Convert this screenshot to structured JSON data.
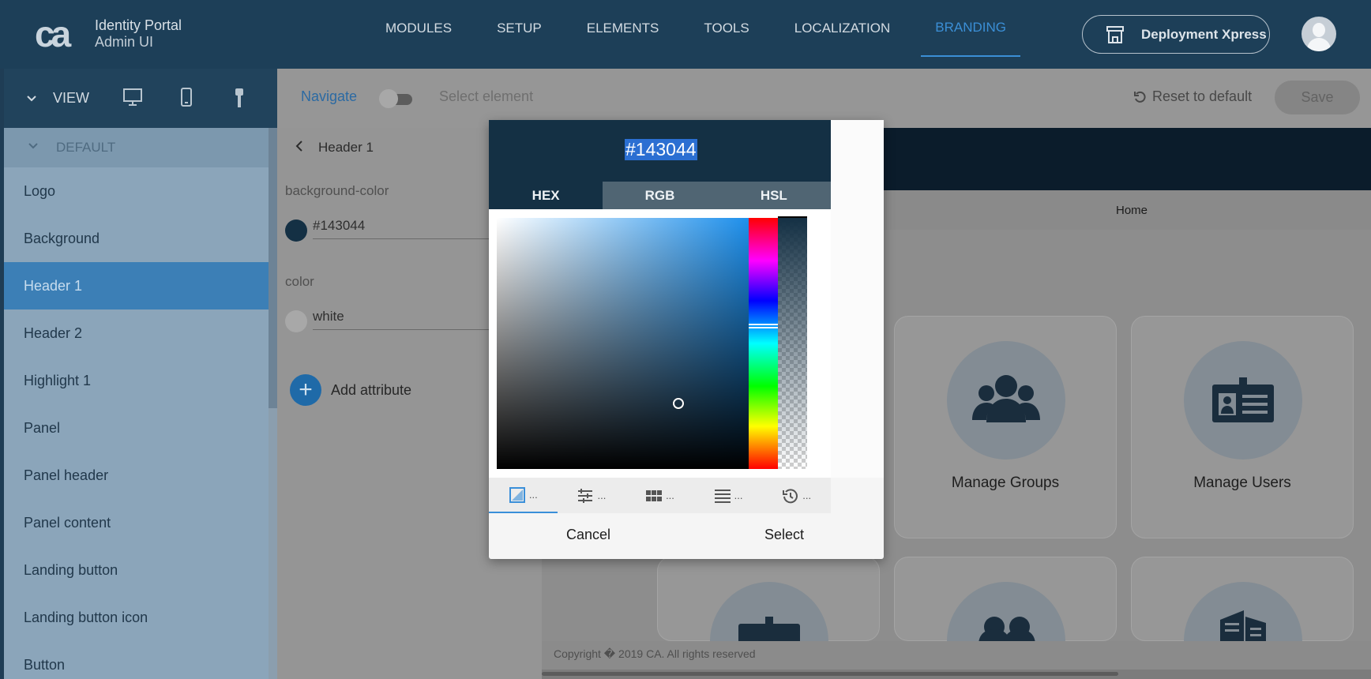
{
  "app": {
    "logo_mark": "ca",
    "title_line1": "Identity Portal",
    "title_line2": "Admin UI"
  },
  "topnav": {
    "items": [
      {
        "label": "MODULES",
        "active": false
      },
      {
        "label": "SETUP",
        "active": false
      },
      {
        "label": "ELEMENTS",
        "active": false
      },
      {
        "label": "TOOLS",
        "active": false
      },
      {
        "label": "LOCALIZATION",
        "active": false
      },
      {
        "label": "BRANDING",
        "active": true
      }
    ],
    "deploy_button": "Deployment Xpress",
    "deploy_icon": "store-icon",
    "avatar_icon": "user-avatar-icon"
  },
  "viewbar": {
    "label": "VIEW",
    "devices": [
      "desktop-icon",
      "mobile-icon",
      "brush-icon"
    ]
  },
  "sidebar": {
    "section": "DEFAULT",
    "items": [
      {
        "label": "Logo",
        "selected": false
      },
      {
        "label": "Background",
        "selected": false
      },
      {
        "label": "Header 1",
        "selected": true
      },
      {
        "label": "Header 2",
        "selected": false
      },
      {
        "label": "Highlight 1",
        "selected": false
      },
      {
        "label": "Panel",
        "selected": false
      },
      {
        "label": "Panel header",
        "selected": false
      },
      {
        "label": "Panel content",
        "selected": false
      },
      {
        "label": "Landing button",
        "selected": false
      },
      {
        "label": "Landing button icon",
        "selected": false
      },
      {
        "label": "Button",
        "selected": false
      }
    ]
  },
  "toolbar": {
    "navigate": "Navigate",
    "select_element": "Select element",
    "reset": "Reset to default",
    "save": "Save"
  },
  "attributes": {
    "title": "Header 1",
    "items": [
      {
        "name": "background-color",
        "value": "#143044",
        "swatch": "#143044"
      },
      {
        "name": "color",
        "value": "white",
        "swatch": "#ffffff"
      }
    ],
    "add_label": "Add attribute"
  },
  "preview": {
    "breadcrumb": "Home",
    "tiles": [
      {
        "label": "Manage Groups",
        "icon": "users-group-icon"
      },
      {
        "label": "Manage Users",
        "icon": "id-badge-icon"
      },
      {
        "label": "",
        "icon": "id-card-icon"
      },
      {
        "label": "",
        "icon": "two-users-icon"
      },
      {
        "label": "",
        "icon": "buildings-icon"
      }
    ],
    "footer": "Copyright � 2019 CA. All rights reserved"
  },
  "color_picker": {
    "hex_value": "#143044",
    "tabs": [
      {
        "label": "HEX",
        "active": true
      },
      {
        "label": "RGB",
        "active": false
      },
      {
        "label": "HSL",
        "active": false
      }
    ],
    "modes": [
      {
        "icon": "gradient-palette-icon",
        "label": "...",
        "active": true
      },
      {
        "icon": "sliders-icon",
        "label": "...",
        "active": false
      },
      {
        "icon": "grid-swatches-icon",
        "label": "...",
        "active": false
      },
      {
        "icon": "list-icon",
        "label": "...",
        "active": false
      },
      {
        "icon": "history-icon",
        "label": "...",
        "active": false
      }
    ],
    "cancel": "Cancel",
    "select": "Select",
    "colors": {
      "selected": "#143044",
      "accent": "#1e90ec"
    }
  },
  "colors": {
    "header_bg": "#1d3f58",
    "accent": "#3b8fd6",
    "sidebar_selected": "#3c7fb6"
  }
}
